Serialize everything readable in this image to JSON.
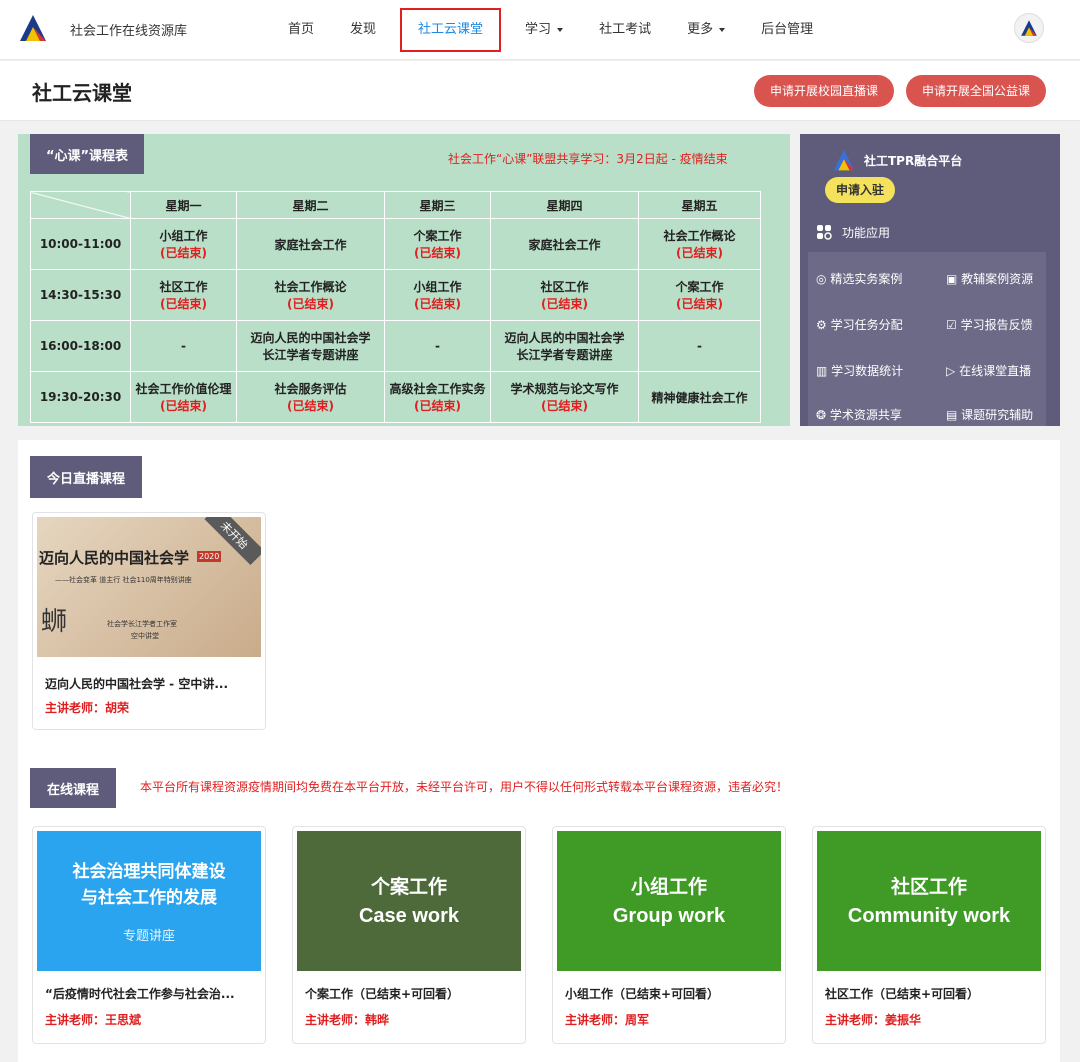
{
  "header": {
    "site_title": "社会工作在线资源库",
    "nav": [
      {
        "label": "首页"
      },
      {
        "label": "发现"
      },
      {
        "label": "社工云课堂"
      },
      {
        "label": "学习"
      },
      {
        "label": "社工考试"
      },
      {
        "label": "更多"
      },
      {
        "label": "后台管理"
      }
    ]
  },
  "page": {
    "title": "社工云课堂",
    "btn_campus": "申请开展校园直播课",
    "btn_national": "申请开展全国公益课"
  },
  "schedule": {
    "tag": "“心课”课程表",
    "notice": "社会工作“心课”联盟共享学习：3月2日起 - 疫情结束",
    "days": [
      "星期一",
      "星期二",
      "星期三",
      "星期四",
      "星期五"
    ],
    "ended_label": "(已结束)",
    "rows": [
      {
        "time": "10:00-11:00",
        "cells": [
          {
            "text": "小组工作",
            "ended": "(已结束)"
          },
          {
            "text": "家庭社会工作",
            "ended": ""
          },
          {
            "text": "个案工作",
            "ended": "(已结束)"
          },
          {
            "text": "家庭社会工作",
            "ended": ""
          },
          {
            "text": "社会工作概论",
            "ended": "(已结束)"
          }
        ]
      },
      {
        "time": "14:30-15:30",
        "cells": [
          {
            "text": "社区工作",
            "ended": "(已结束)"
          },
          {
            "text": "社会工作概论",
            "ended": "(已结束)"
          },
          {
            "text": "小组工作",
            "ended": "(已结束)"
          },
          {
            "text": "社区工作",
            "ended": "(已结束)"
          },
          {
            "text": "个案工作",
            "ended": "(已结束)"
          }
        ]
      },
      {
        "time": "16:00-18:00",
        "cells": [
          {
            "text": "-",
            "ended": ""
          },
          {
            "text": "迈向人民的中国社会学",
            "text2": "长江学者专题讲座",
            "ended": ""
          },
          {
            "text": "-",
            "ended": ""
          },
          {
            "text": "迈向人民的中国社会学",
            "text2": "长江学者专题讲座",
            "ended": ""
          },
          {
            "text": "-",
            "ended": ""
          }
        ]
      },
      {
        "time": "19:30-20:30",
        "cells": [
          {
            "text": "社会工作价值伦理",
            "ended": "(已结束)"
          },
          {
            "text": "社会服务评估",
            "ended": "(已结束)"
          },
          {
            "text": "高级社会工作实务",
            "ended": "(已结束)"
          },
          {
            "text": "学术规范与论文写作",
            "ended": "(已结束)"
          },
          {
            "text": "精神健康社会工作",
            "ended": ""
          }
        ]
      }
    ]
  },
  "tpr": {
    "title": "社工TPR融合平台",
    "join": "申请入驻",
    "functions_title": "功能应用",
    "items": [
      {
        "label": "精选实务案例",
        "icon": "target-icon"
      },
      {
        "label": "教辅案例资源",
        "icon": "document-icon"
      },
      {
        "label": "学习任务分配",
        "icon": "gear-icon"
      },
      {
        "label": "学习报告反馈",
        "icon": "clipboard-icon"
      },
      {
        "label": "学习数据统计",
        "icon": "bar-chart-icon"
      },
      {
        "label": "在线课堂直播",
        "icon": "video-icon"
      },
      {
        "label": "学术资源共享",
        "icon": "share-icon"
      },
      {
        "label": "课题研究辅助",
        "icon": "book-icon"
      }
    ]
  },
  "live": {
    "tag": "今日直播课程",
    "card": {
      "ribbon": "未开始",
      "title": "迈向人民的中国社会学 - 空中讲...",
      "teacher": "主讲老师：胡荣",
      "poster_title": "迈向人民的中国社会学",
      "poster_sub": "——社会变革  道主行 社会110周年特别讲座",
      "poster_mark": "社会学长江学者工作室",
      "poster_mark2": "空中讲堂",
      "poster_year": "2020"
    }
  },
  "online": {
    "tag": "在线课程",
    "notice": "本平台所有课程资源疫情期间均免费在本平台开放，未经平台许可，用户不得以任何形式转载本平台课程资源，违者必究！",
    "courses": [
      {
        "cover_cn1": "社会治理共同体建设",
        "cover_cn2": "与社会工作的发展",
        "cover_sub": "专题讲座",
        "title": "“后疫情时代社会工作参与社会治...",
        "teacher": "主讲老师：王思斌",
        "color": "#2aa4ee"
      },
      {
        "cover_cn1": "个案工作",
        "cover_en": "Case work",
        "title": "个案工作（已结束+可回看）",
        "teacher": "主讲老师：韩晔",
        "color": "#4e6a3a"
      },
      {
        "cover_cn1": "小组工作",
        "cover_en": "Group work",
        "title": "小组工作（已结束+可回看）",
        "teacher": "主讲老师：周军",
        "color": "#3f9a26"
      },
      {
        "cover_cn1": "社区工作",
        "cover_en": "Community work",
        "title": "社区工作（已结束+可回看）",
        "teacher": "主讲老师：姜振华",
        "color": "#3f9a26"
      }
    ]
  }
}
